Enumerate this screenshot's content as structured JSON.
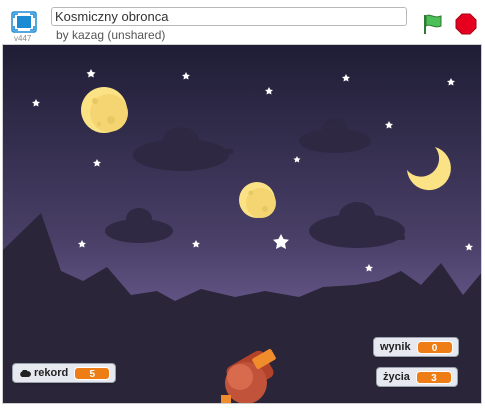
{
  "project": {
    "title": "Kosmiczny obronca",
    "byline": "by kazag (unshared)",
    "version": "v447"
  },
  "controls": {
    "green_flag": "green-flag-icon",
    "stop": "stop-sign-icon",
    "fullscreen": "fullscreen-icon"
  },
  "monitors": {
    "record": {
      "label": "rekord",
      "value": "5",
      "cloud": true
    },
    "score": {
      "label": "wynik",
      "value": "0"
    },
    "lives": {
      "label": "życia",
      "value": "3"
    }
  },
  "colors": {
    "sky_top": "#1f1d35",
    "sky_bottom": "#6d5d92",
    "mountains": "#2a2538",
    "moon": "#fbe285",
    "monitor_value": "#ee7d16",
    "flag": "#4cbf56",
    "stop": "#e6001f"
  }
}
